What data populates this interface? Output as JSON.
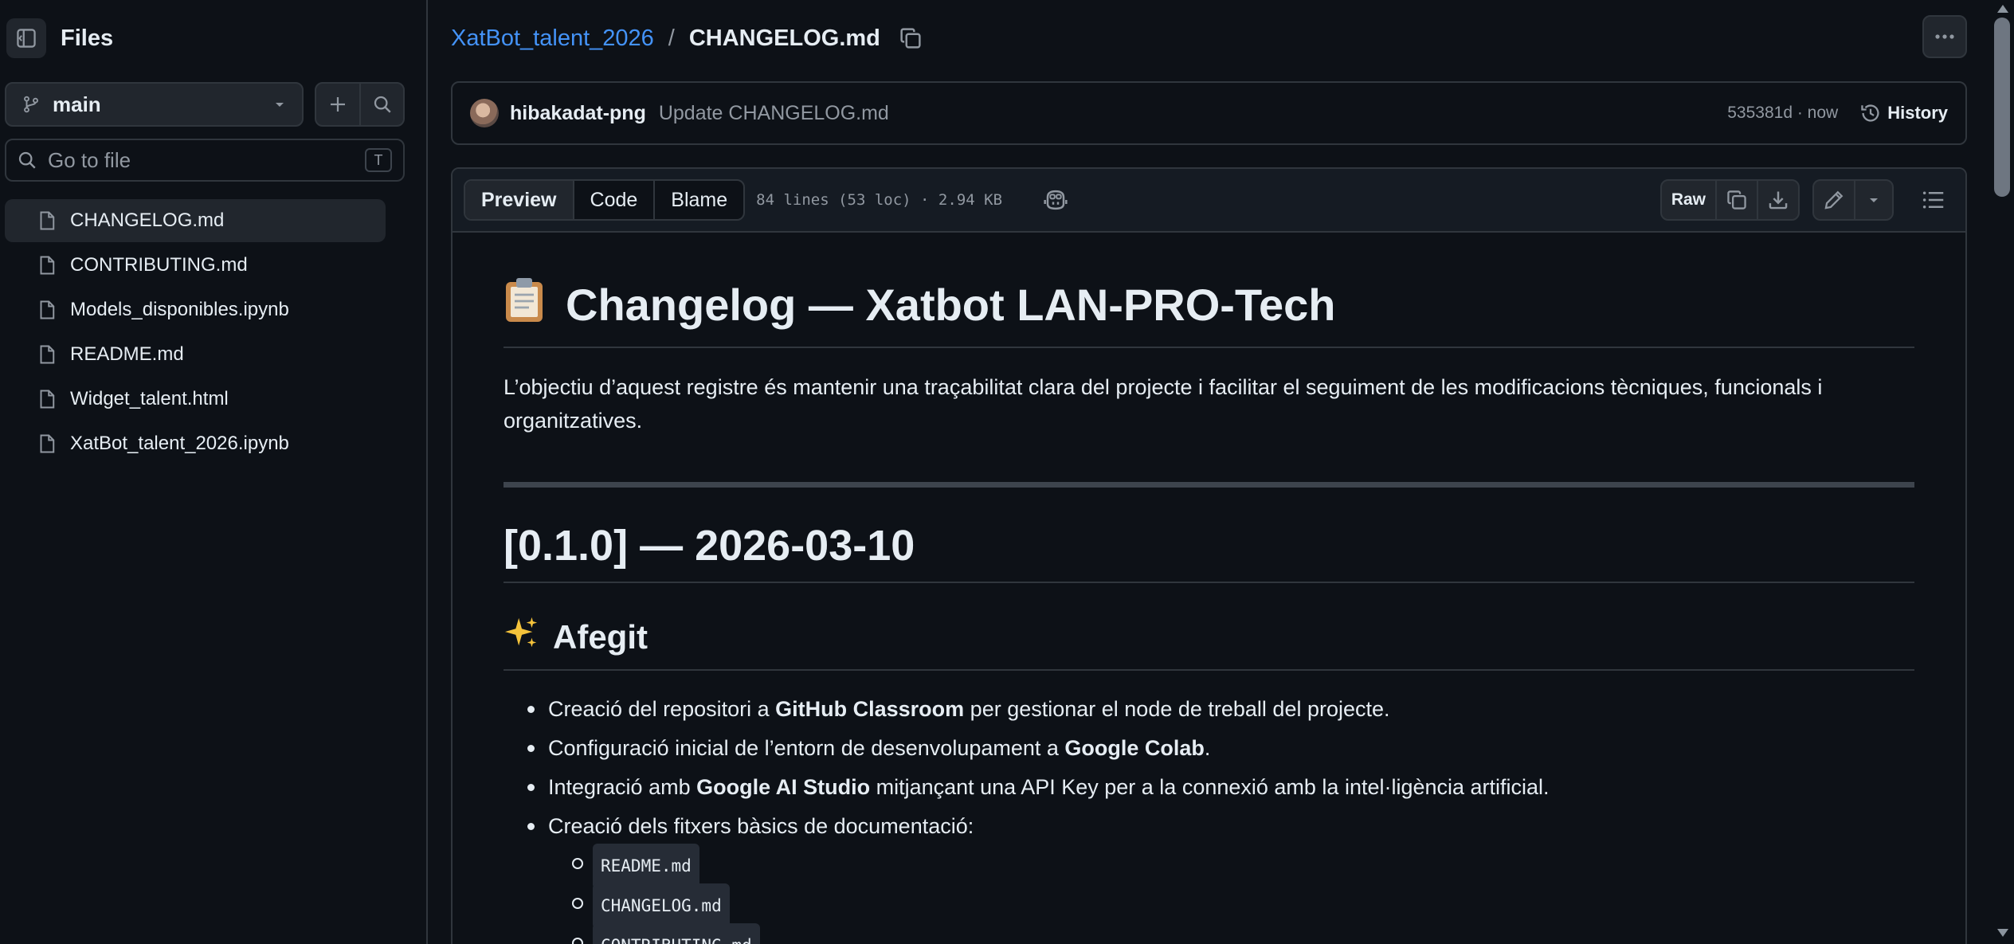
{
  "sidebar": {
    "title": "Files",
    "branch": "main",
    "goto_placeholder": "Go to file",
    "goto_shortcut": "T",
    "files": [
      {
        "name": "CHANGELOG.md"
      },
      {
        "name": "CONTRIBUTING.md"
      },
      {
        "name": "Models_disponibles.ipynb"
      },
      {
        "name": "README.md"
      },
      {
        "name": "Widget_talent.html"
      },
      {
        "name": "XatBot_talent_2026.ipynb"
      }
    ]
  },
  "breadcrumb": {
    "repo": "XatBot_talent_2026",
    "separator": "/",
    "file": "CHANGELOG.md"
  },
  "commit": {
    "author": "hibakadat-png",
    "message": "Update CHANGELOG.md",
    "sha_time": "535381d · now",
    "history_label": "History"
  },
  "toolbar": {
    "tabs": [
      "Preview",
      "Code",
      "Blame"
    ],
    "meta": "84 lines (53 loc) · 2.94 KB",
    "raw_label": "Raw"
  },
  "content": {
    "h1": "Changelog — Xatbot LAN-PRO-Tech",
    "intro": "L’objectiu d’aquest registre és mantenir una traçabilitat clara del projecte i facilitar el seguiment de les modificacions tècniques, funcionals i organitzatives.",
    "version": "[0.1.0] — 2026-03-10",
    "section": "Afegit",
    "bullets": [
      {
        "pre": "Creació del repositori a ",
        "bold": "GitHub Classroom",
        "post": " per gestionar el node de treball del projecte."
      },
      {
        "pre": "Configuració inicial de l’entorn de desenvolupament a ",
        "bold": "Google Colab",
        "post": "."
      },
      {
        "pre": "Integració amb ",
        "bold": "Google AI Studio",
        "post": " mitjançant una API Key per a la connexió amb la intel·ligència artificial."
      },
      {
        "pre": "Creació dels fitxers bàsics de documentació:",
        "bold": "",
        "post": ""
      }
    ],
    "docs": [
      "README.md",
      "CHANGELOG.md",
      "CONTRIBUTING.md"
    ]
  },
  "colors": {
    "background": "#0d1117",
    "border": "#30363d",
    "link": "#4493f8",
    "muted": "#9198a1"
  }
}
